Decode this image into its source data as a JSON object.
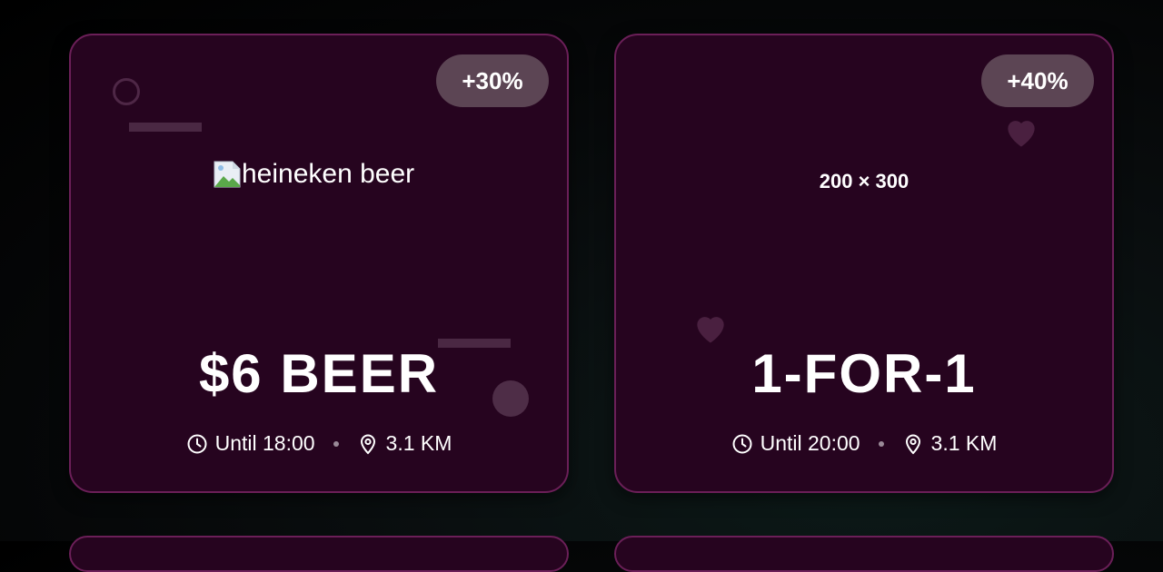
{
  "cards": [
    {
      "badge": "+30%",
      "image_alt": "heineken beer",
      "headline": "$6 BEER",
      "time": "Until 18:00",
      "distance": "3.1 KM"
    },
    {
      "badge": "+40%",
      "image_placeholder": "200 × 300",
      "headline": "1-FOR-1",
      "time": "Until 20:00",
      "distance": "3.1 KM"
    }
  ],
  "icons": {
    "time": "clock-icon",
    "distance": "location-pin-icon",
    "decor": "heart-icon"
  },
  "colors": {
    "card_bg": "#26041f",
    "card_border": "#6b1f58",
    "badge_bg": "#5c4554"
  }
}
